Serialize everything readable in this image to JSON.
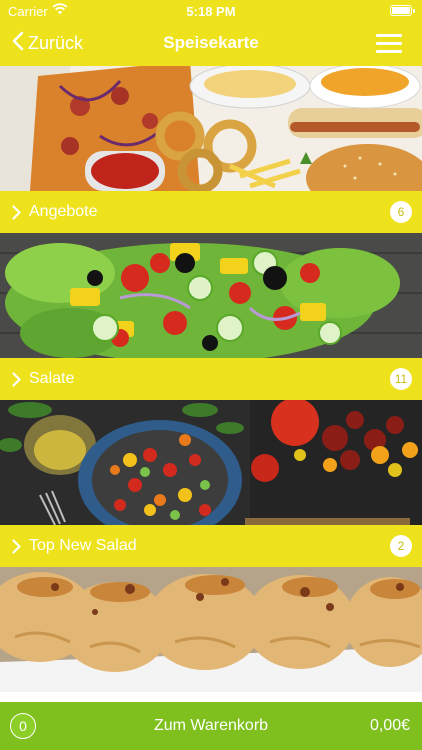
{
  "status_bar": {
    "carrier": "Carrier",
    "time": "5:18 PM"
  },
  "nav": {
    "back_label": "Zurück",
    "title": "Speisekarte"
  },
  "categories": [
    {
      "label": "",
      "count": ""
    },
    {
      "label": "Angebote",
      "count": "6"
    },
    {
      "label": "Salate",
      "count": "11"
    },
    {
      "label": "Top New Salad",
      "count": "2"
    }
  ],
  "cart": {
    "quantity": "0",
    "label": "Zum Warenkorb",
    "total": "0,00€"
  },
  "colors": {
    "accent": "#eee21d",
    "cart_bar": "#7fbf1e",
    "text": "#ffffff"
  }
}
